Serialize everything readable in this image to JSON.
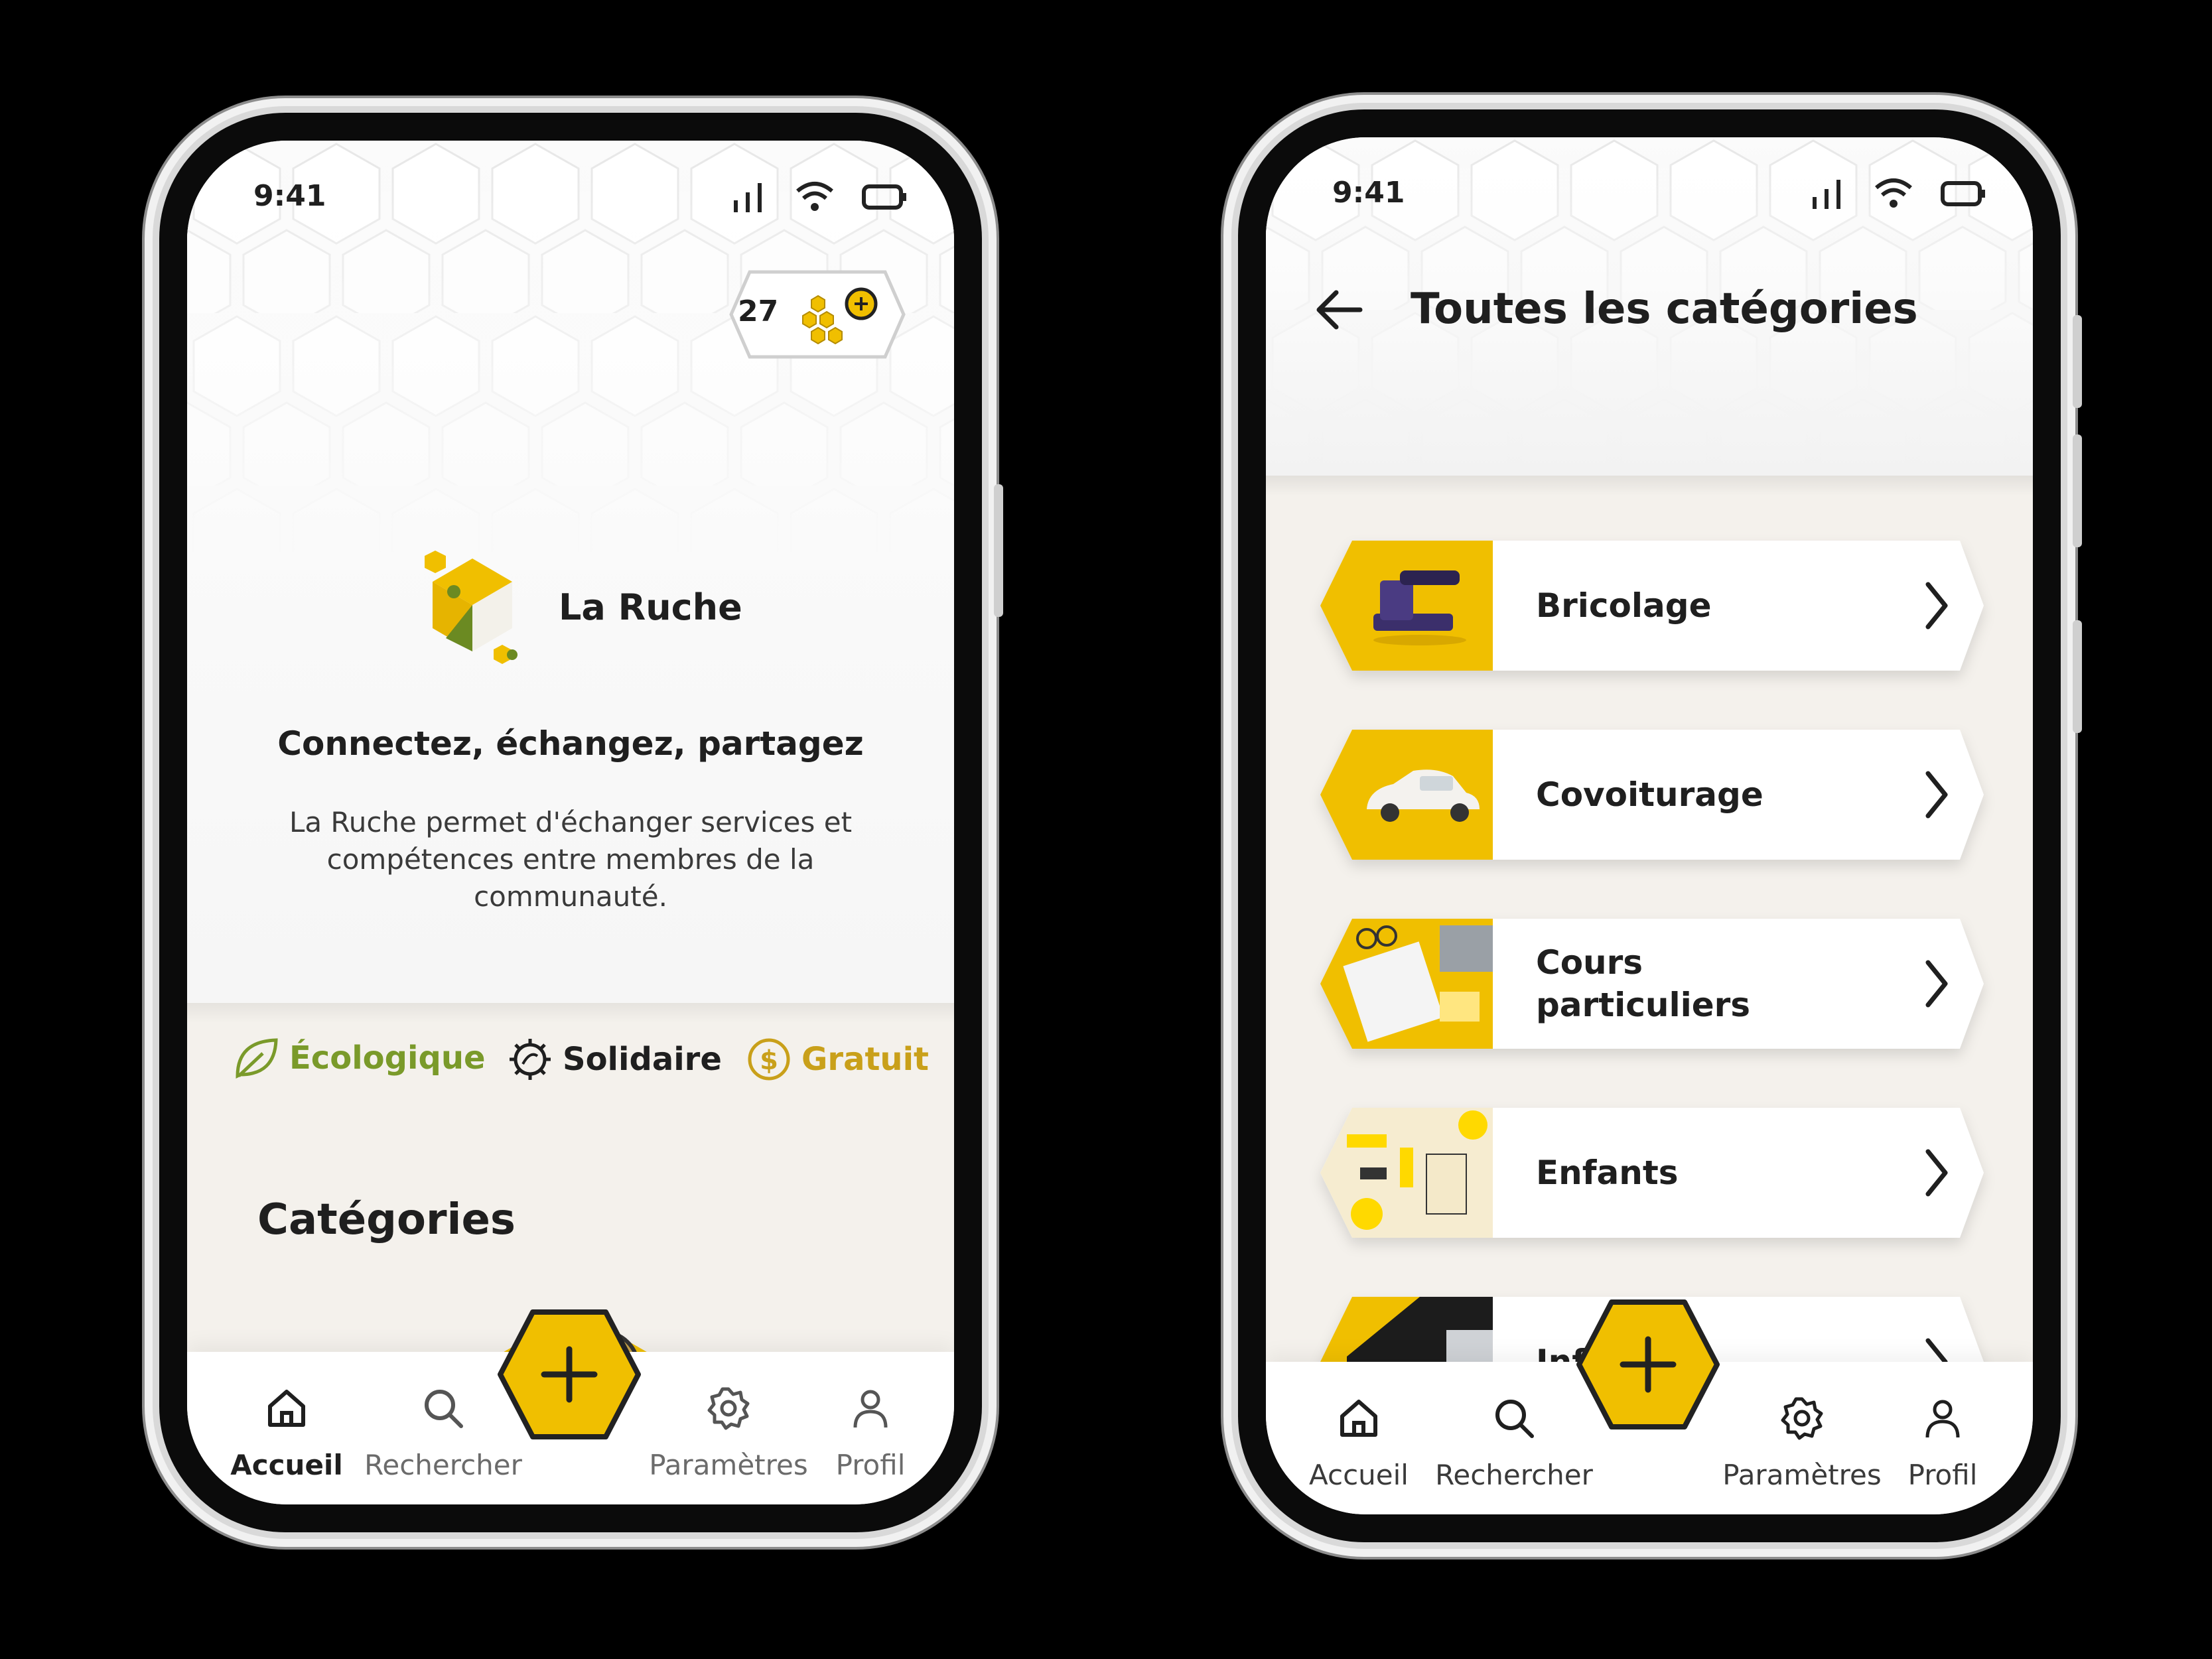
{
  "colors": {
    "accent": "#f0bf00",
    "dark": "#1f1f1f",
    "green": "#7a9a2a",
    "gold": "#c9a01a",
    "bg": "#f4f1ec"
  },
  "home": {
    "status": {
      "time": "9:41"
    },
    "coins": {
      "count": "27",
      "icon": "honeycomb-coin-icon"
    },
    "brand": {
      "name": "La Ruche",
      "logo": "la-ruche-logo"
    },
    "tagline": "Connectez, échangez, partagez",
    "description": "La Ruche permet d'échanger services et compétences entre membres de la communauté.",
    "values": [
      {
        "label": "Écologique",
        "icon": "leaf-icon",
        "color": "#7a9a2a"
      },
      {
        "label": "Solidaire",
        "icon": "solidarity-icon",
        "color": "#1f1f1f"
      },
      {
        "label": "Gratuit",
        "icon": "dollar-coin-icon",
        "color": "#c9a01a"
      }
    ],
    "section_title": "Catégories",
    "nav": [
      {
        "label": "Accueil",
        "icon": "home-icon",
        "active": true
      },
      {
        "label": "Rechercher",
        "icon": "search-icon",
        "active": false
      },
      {
        "label": "Paramètres",
        "icon": "gear-icon",
        "active": false
      },
      {
        "label": "Profil",
        "icon": "user-icon",
        "active": false
      }
    ],
    "fab_icon": "plus-icon"
  },
  "categories_screen": {
    "status": {
      "time": "9:41"
    },
    "title": "Toutes les catégories",
    "back_icon": "arrow-left-icon",
    "categories": [
      {
        "label": "Bricolage",
        "image": "stapler-photo"
      },
      {
        "label": "Covoiturage",
        "image": "car-photo"
      },
      {
        "label": "Cours particuliers",
        "image": "desk-photo"
      },
      {
        "label": "Enfants",
        "image": "toys-photo"
      },
      {
        "label": "Inf",
        "image": "laptop-photo"
      }
    ],
    "nav": [
      {
        "label": "Accueil",
        "icon": "home-icon",
        "active": false
      },
      {
        "label": "Rechercher",
        "icon": "search-icon",
        "active": false
      },
      {
        "label": "Paramètres",
        "icon": "gear-icon",
        "active": false
      },
      {
        "label": "Profil",
        "icon": "user-icon",
        "active": false
      }
    ],
    "fab_icon": "plus-icon"
  }
}
